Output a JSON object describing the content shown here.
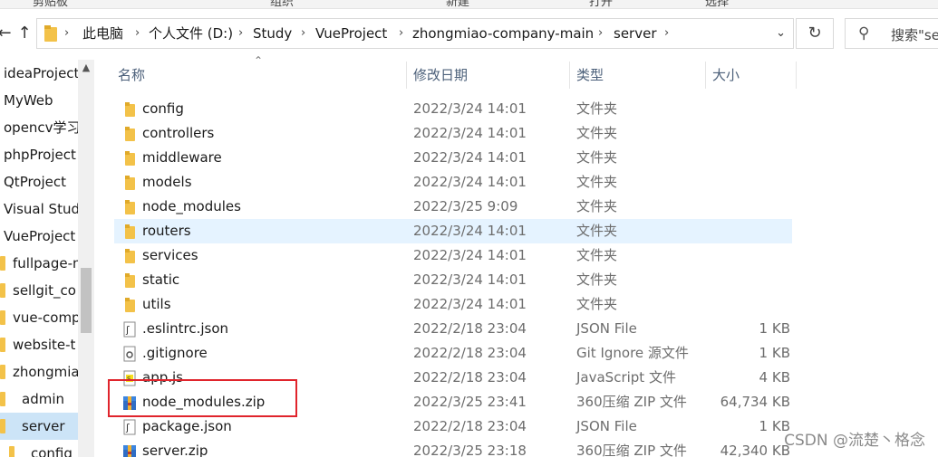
{
  "ribbon": {
    "labels": [
      "剪贴板",
      "组织",
      "新建",
      "打开",
      "选择"
    ]
  },
  "nav": {
    "back_icon": "arrow-left-icon",
    "up_icon": "arrow-up-icon",
    "breadcrumbs": [
      "此电脑",
      "个人文件 (D:)",
      "Study",
      "VueProject",
      "zhongmiao-company-main",
      "server"
    ],
    "refresh_icon": "refresh-icon",
    "search_placeholder": "搜索\"se"
  },
  "sidebar": {
    "items": [
      {
        "label": "ideaProject",
        "selected": false,
        "folder": false
      },
      {
        "label": "MyWeb",
        "selected": false,
        "folder": false
      },
      {
        "label": "opencv学习",
        "selected": false,
        "folder": false
      },
      {
        "label": "phpProject",
        "selected": false,
        "folder": false
      },
      {
        "label": "QtProject",
        "selected": false,
        "folder": false
      },
      {
        "label": "Visual Studio",
        "selected": false,
        "folder": false
      },
      {
        "label": "VueProject",
        "selected": false,
        "folder": false
      },
      {
        "label": "fullpage-m",
        "selected": false,
        "folder": true
      },
      {
        "label": "sellgit_co",
        "selected": false,
        "folder": true
      },
      {
        "label": "vue-comp",
        "selected": false,
        "folder": true
      },
      {
        "label": "website-t",
        "selected": false,
        "folder": true
      },
      {
        "label": "zhongmiao",
        "selected": false,
        "folder": true
      },
      {
        "label": "admin",
        "selected": false,
        "folder": true
      },
      {
        "label": "server",
        "selected": true,
        "folder": true
      },
      {
        "label": "config",
        "selected": false,
        "folder": true
      }
    ]
  },
  "file_list": {
    "columns": [
      "名称",
      "修改日期",
      "类型",
      "大小"
    ],
    "rows": [
      {
        "name": "config",
        "date": "2022/3/24 14:01",
        "type": "文件夹",
        "size": "",
        "icon": "folder"
      },
      {
        "name": "controllers",
        "date": "2022/3/24 14:01",
        "type": "文件夹",
        "size": "",
        "icon": "folder"
      },
      {
        "name": "middleware",
        "date": "2022/3/24 14:01",
        "type": "文件夹",
        "size": "",
        "icon": "folder"
      },
      {
        "name": "models",
        "date": "2022/3/24 14:01",
        "type": "文件夹",
        "size": "",
        "icon": "folder"
      },
      {
        "name": "node_modules",
        "date": "2022/3/25 9:09",
        "type": "文件夹",
        "size": "",
        "icon": "folder"
      },
      {
        "name": "routers",
        "date": "2022/3/24 14:01",
        "type": "文件夹",
        "size": "",
        "icon": "folder",
        "hover": true
      },
      {
        "name": "services",
        "date": "2022/3/24 14:01",
        "type": "文件夹",
        "size": "",
        "icon": "folder"
      },
      {
        "name": "static",
        "date": "2022/3/24 14:01",
        "type": "文件夹",
        "size": "",
        "icon": "folder"
      },
      {
        "name": "utils",
        "date": "2022/3/24 14:01",
        "type": "文件夹",
        "size": "",
        "icon": "folder"
      },
      {
        "name": ".eslintrc.json",
        "date": "2022/2/18 23:04",
        "type": "JSON File",
        "size": "1 KB",
        "icon": "json"
      },
      {
        "name": ".gitignore",
        "date": "2022/2/18 23:04",
        "type": "Git Ignore 源文件",
        "size": "1 KB",
        "icon": "gitignore"
      },
      {
        "name": "app.js",
        "date": "2022/2/18 23:04",
        "type": "JavaScript 文件",
        "size": "4 KB",
        "icon": "js"
      },
      {
        "name": "node_modules.zip",
        "date": "2022/3/25 23:41",
        "type": "360压缩 ZIP 文件",
        "size": "64,734 KB",
        "icon": "zip"
      },
      {
        "name": "package.json",
        "date": "2022/2/18 23:04",
        "type": "JSON File",
        "size": "1 KB",
        "icon": "json"
      },
      {
        "name": "server.zip",
        "date": "2022/3/25 23:18",
        "type": "360压缩 ZIP 文件",
        "size": "42,340 KB",
        "icon": "zip"
      }
    ]
  },
  "annotation": {
    "color": "#e0242c"
  },
  "watermark": {
    "text": "CSDN @流楚丶格念"
  },
  "colors": {
    "folder": "#f3c249",
    "selection": "#cce4f7",
    "hover": "#e5f3ff"
  }
}
